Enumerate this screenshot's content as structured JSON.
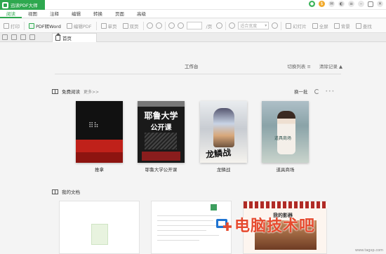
{
  "app": {
    "title": "迅读PDF大师"
  },
  "menu": {
    "items": [
      "阅读",
      "视图",
      "注释",
      "编辑",
      "转换",
      "页面",
      "高级"
    ],
    "active_index": 0
  },
  "toolbar": {
    "print": "打印",
    "pdf_to_word": "PDF转Word",
    "edit_pdf": "编辑PDF",
    "single_page": "单页",
    "double_page": "双页",
    "page_total": "/页",
    "zoom_placeholder": "适合宽度",
    "slideshow": "幻灯片",
    "fullscreen": "全屏",
    "background": "背景",
    "search": "查找"
  },
  "tabs": {
    "home": "首页"
  },
  "workspace": {
    "title": "工作台",
    "switch_list": "切换列表",
    "clear_history": "清除记录"
  },
  "free_reading": {
    "title": "免费阅读",
    "more": "更多>>",
    "refresh": "换一批",
    "books": [
      {
        "title": "推拿"
      },
      {
        "title": "耶鲁大学公开课"
      },
      {
        "title": "龙鳞战"
      },
      {
        "title": "道具商场"
      }
    ],
    "book2_cover_line1": "耶鲁大学",
    "book2_cover_line2": "公开课",
    "book4_cover": "道具商场"
  },
  "my_docs": {
    "title": "我的文档",
    "card3_title": "我的影器"
  },
  "watermark": {
    "text": "电脑技术吧",
    "sub": "www.tagxp.com"
  },
  "colors": {
    "brand_green": "#2ea84f",
    "watermark_red": "#e64a2e",
    "watermark_blue": "#1f74d1"
  }
}
